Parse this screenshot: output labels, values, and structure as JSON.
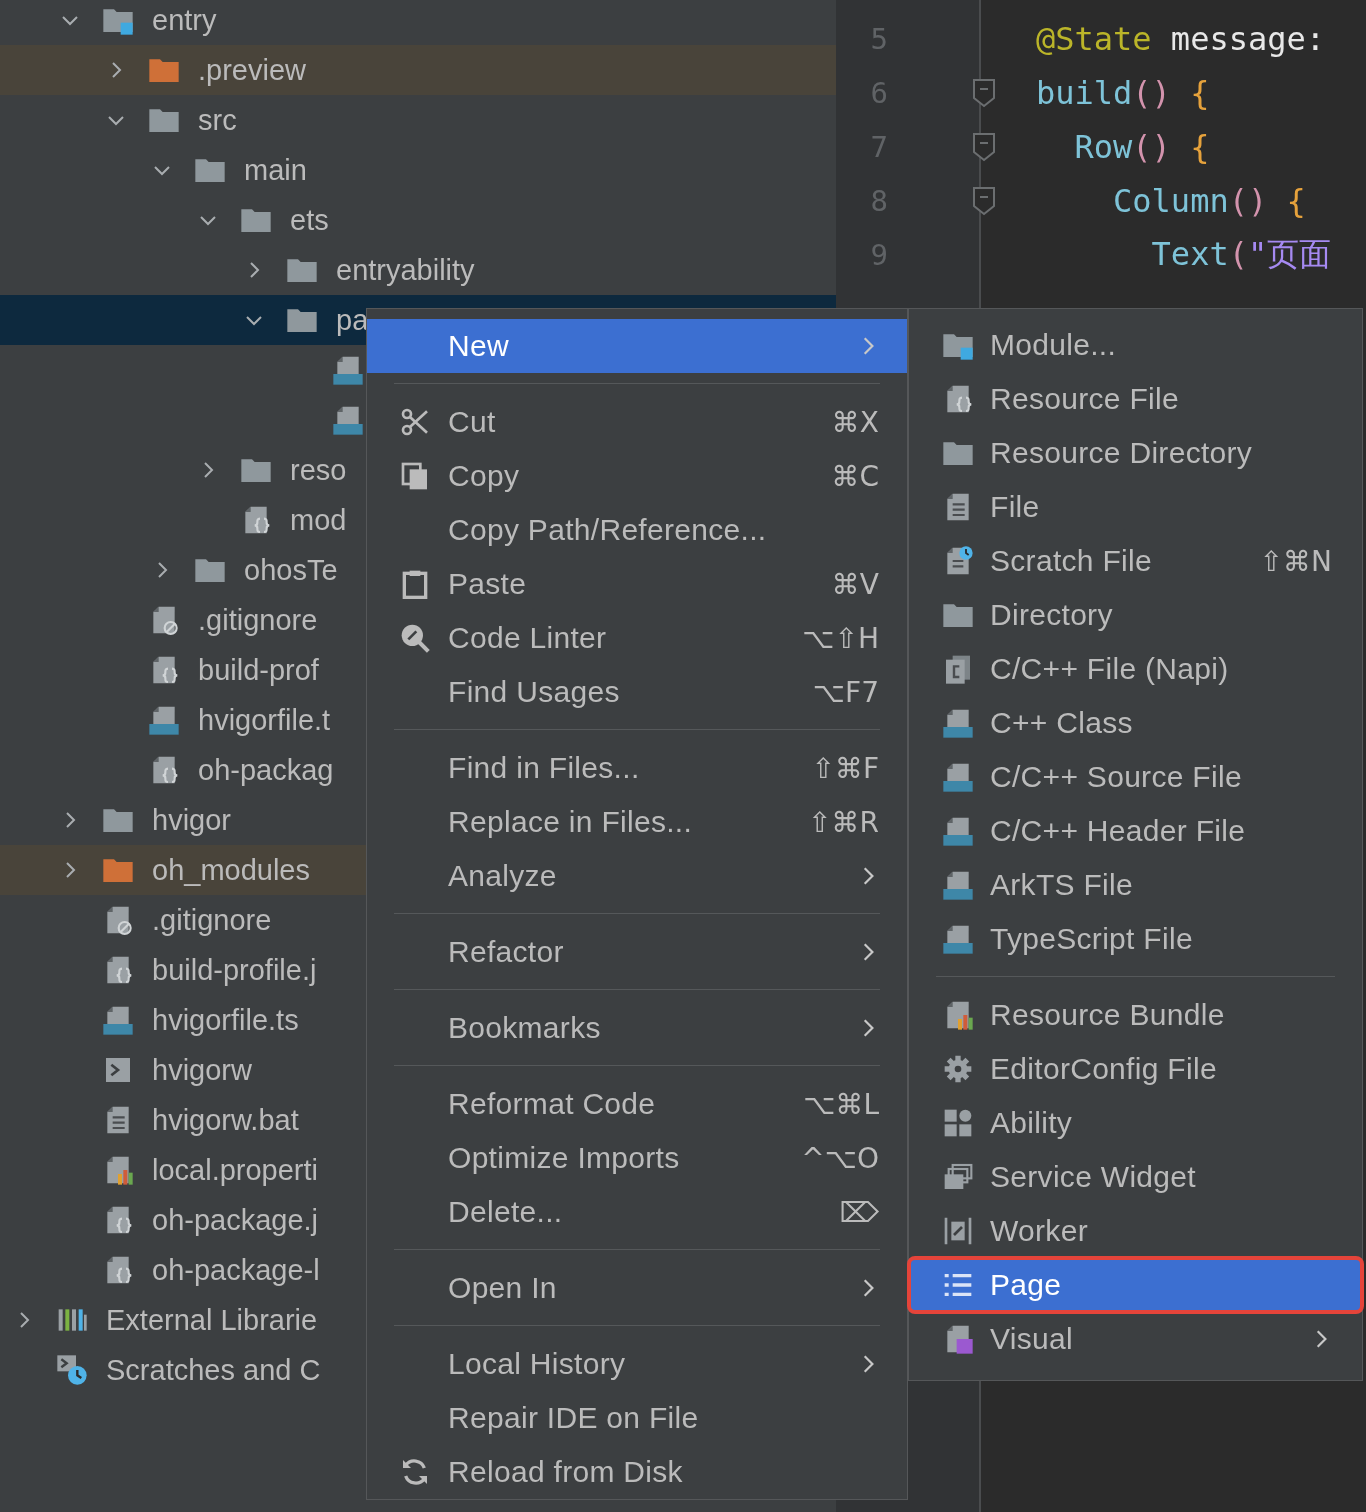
{
  "project_tree": {
    "items": [
      {
        "label": "entry",
        "kind": "module",
        "expanded": true,
        "selected": false,
        "children": [
          {
            "label": ".preview",
            "kind": "excluded-folder",
            "expanded": false,
            "selected": false
          },
          {
            "label": "src",
            "kind": "folder",
            "expanded": true,
            "selected": false,
            "children": [
              {
                "label": "main",
                "kind": "folder",
                "expanded": true,
                "selected": false,
                "children": [
                  {
                    "label": "ets",
                    "kind": "folder",
                    "expanded": true,
                    "selected": false,
                    "children": [
                      {
                        "label": "entryability",
                        "kind": "folder",
                        "expanded": false,
                        "selected": false
                      },
                      {
                        "label": "pa",
                        "kind": "folder",
                        "expanded": true,
                        "selected": true,
                        "children": [
                          {
                            "kind": "ets-file",
                            "selected": false
                          },
                          {
                            "kind": "ets-file",
                            "selected": false
                          }
                        ]
                      }
                    ]
                  },
                  {
                    "label": "reso",
                    "kind": "folder",
                    "expanded": false,
                    "selected": false
                  },
                  {
                    "label": "mod",
                    "kind": "json-file",
                    "selected": false
                  }
                ]
              },
              {
                "label": "ohosTe",
                "kind": "folder",
                "expanded": false,
                "selected": false
              }
            ]
          },
          {
            "label": ".gitignore",
            "kind": "ignore-file",
            "selected": false
          },
          {
            "label": "build-prof",
            "kind": "json-file",
            "selected": false
          },
          {
            "label": "hvigorfile.t",
            "kind": "ts-file",
            "selected": false
          },
          {
            "label": "oh-packag",
            "kind": "json-file",
            "selected": false
          }
        ]
      },
      {
        "label": "hvigor",
        "kind": "folder",
        "expanded": false,
        "selected": false
      },
      {
        "label": "oh_modules",
        "kind": "excluded-folder",
        "expanded": false,
        "selected": false
      },
      {
        "label": ".gitignore",
        "kind": "ignore-file",
        "selected": false
      },
      {
        "label": "build-profile.j",
        "kind": "json-file",
        "selected": false
      },
      {
        "label": "hvigorfile.ts",
        "kind": "ts-file",
        "selected": false
      },
      {
        "label": "hvigorw",
        "kind": "terminal-file",
        "selected": false
      },
      {
        "label": "hvigorw.bat",
        "kind": "text-file",
        "selected": false
      },
      {
        "label": "local.properti",
        "kind": "properties-file",
        "selected": false
      },
      {
        "label": "oh-package.j",
        "kind": "json-file",
        "selected": false
      },
      {
        "label": "oh-package-l",
        "kind": "json-file",
        "selected": false
      }
    ],
    "root_items": [
      {
        "label": "External Librarie",
        "kind": "libraries",
        "expanded": false,
        "selected": false
      },
      {
        "label": "Scratches and C",
        "kind": "scratches",
        "selected": false
      }
    ]
  },
  "editor": {
    "lines": [
      {
        "number": "5",
        "foldable": false,
        "tokens": [
          {
            "text": "@State",
            "kind": "decorator"
          },
          {
            "text": " message:",
            "kind": "plain"
          }
        ]
      },
      {
        "number": "6",
        "foldable": true,
        "tokens": [
          {
            "text": "build",
            "kind": "call"
          },
          {
            "text": "()",
            "kind": "paren"
          },
          {
            "text": " {",
            "kind": "brace"
          }
        ]
      },
      {
        "number": "7",
        "foldable": true,
        "tokens": [
          {
            "text": "  Row",
            "kind": "call"
          },
          {
            "text": "()",
            "kind": "paren"
          },
          {
            "text": " {",
            "kind": "brace"
          }
        ]
      },
      {
        "number": "8",
        "foldable": true,
        "tokens": [
          {
            "text": "    Column",
            "kind": "call"
          },
          {
            "text": "()",
            "kind": "paren"
          },
          {
            "text": " {",
            "kind": "brace"
          }
        ]
      },
      {
        "number": "9",
        "foldable": false,
        "tokens": [
          {
            "text": "      Text",
            "kind": "call"
          },
          {
            "text": "(",
            "kind": "paren"
          },
          {
            "text": "\"页面",
            "kind": "string"
          }
        ]
      }
    ]
  },
  "context_menu": {
    "groups": [
      [
        {
          "label": "New",
          "kind": "plain",
          "submenu": true,
          "selected": true
        }
      ],
      [
        {
          "label": "Cut",
          "kind": "cut",
          "shortcut": "⌘X",
          "submenu": false,
          "selected": false
        },
        {
          "label": "Copy",
          "kind": "copy",
          "shortcut": "⌘C",
          "submenu": false,
          "selected": false
        },
        {
          "label": "Copy Path/Reference...",
          "kind": "plain",
          "submenu": false,
          "selected": false
        },
        {
          "label": "Paste",
          "kind": "paste",
          "shortcut": "⌘V",
          "submenu": false,
          "selected": false
        },
        {
          "label": "Code Linter",
          "kind": "linter",
          "shortcut": "⌥⇧H",
          "submenu": false,
          "selected": false
        },
        {
          "label": "Find Usages",
          "kind": "plain",
          "shortcut": "⌥F7",
          "submenu": false,
          "selected": false
        }
      ],
      [
        {
          "label": "Find in Files...",
          "kind": "plain",
          "shortcut": "⇧⌘F",
          "submenu": false,
          "selected": false
        },
        {
          "label": "Replace in Files...",
          "kind": "plain",
          "shortcut": "⇧⌘R",
          "submenu": false,
          "selected": false
        },
        {
          "label": "Analyze",
          "kind": "plain",
          "submenu": true,
          "selected": false
        }
      ],
      [
        {
          "label": "Refactor",
          "kind": "plain",
          "submenu": true,
          "selected": false
        }
      ],
      [
        {
          "label": "Bookmarks",
          "kind": "plain",
          "submenu": true,
          "selected": false
        }
      ],
      [
        {
          "label": "Reformat Code",
          "kind": "plain",
          "shortcut": "⌥⌘L",
          "submenu": false,
          "selected": false
        },
        {
          "label": "Optimize Imports",
          "kind": "plain",
          "shortcut": "^⌥O",
          "submenu": false,
          "selected": false
        },
        {
          "label": "Delete...",
          "kind": "plain",
          "shortcut": "⌦",
          "submenu": false,
          "selected": false
        }
      ],
      [
        {
          "label": "Open In",
          "kind": "plain",
          "submenu": true,
          "selected": false
        }
      ],
      [
        {
          "label": "Local History",
          "kind": "plain",
          "submenu": true,
          "selected": false
        },
        {
          "label": "Repair IDE on File",
          "kind": "plain",
          "submenu": false,
          "selected": false
        },
        {
          "label": "Reload from Disk",
          "kind": "reload",
          "submenu": false,
          "selected": false
        }
      ]
    ]
  },
  "new_submenu": {
    "groups": [
      [
        {
          "label": "Module...",
          "kind": "module",
          "submenu": false,
          "selected": false,
          "outlined": false
        },
        {
          "label": "Resource File",
          "kind": "json-file",
          "submenu": false,
          "selected": false,
          "outlined": false
        },
        {
          "label": "Resource Directory",
          "kind": "folder",
          "submenu": false,
          "selected": false,
          "outlined": false
        },
        {
          "label": "File",
          "kind": "text-file",
          "submenu": false,
          "selected": false,
          "outlined": false
        },
        {
          "label": "Scratch File",
          "kind": "scratch-file",
          "shortcut": "⇧⌘N",
          "submenu": false,
          "selected": false,
          "outlined": false
        },
        {
          "label": "Directory",
          "kind": "folder",
          "submenu": false,
          "selected": false,
          "outlined": false
        },
        {
          "label": "C/C++ File (Napi)",
          "kind": "napi-file",
          "submenu": false,
          "selected": false,
          "outlined": false
        },
        {
          "label": "C++ Class",
          "kind": "cpp-file",
          "submenu": false,
          "selected": false,
          "outlined": false
        },
        {
          "label": "C/C++ Source File",
          "kind": "c-file",
          "submenu": false,
          "selected": false,
          "outlined": false
        },
        {
          "label": "C/C++ Header File",
          "kind": "h-file",
          "submenu": false,
          "selected": false,
          "outlined": false
        },
        {
          "label": "ArkTS File",
          "kind": "ets-file",
          "submenu": false,
          "selected": false,
          "outlined": false
        },
        {
          "label": "TypeScript File",
          "kind": "ts-file",
          "submenu": false,
          "selected": false,
          "outlined": false
        }
      ],
      [
        {
          "label": "Resource Bundle",
          "kind": "properties-file",
          "submenu": false,
          "selected": false,
          "outlined": false
        },
        {
          "label": "EditorConfig File",
          "kind": "gear",
          "submenu": false,
          "selected": false,
          "outlined": false
        },
        {
          "label": "Ability",
          "kind": "ability",
          "submenu": false,
          "selected": false,
          "outlined": false
        },
        {
          "label": "Service Widget",
          "kind": "widget",
          "submenu": false,
          "selected": false,
          "outlined": false
        },
        {
          "label": "Worker",
          "kind": "worker",
          "submenu": false,
          "selected": false,
          "outlined": false
        },
        {
          "label": "Page",
          "kind": "page",
          "submenu": false,
          "selected": true,
          "outlined": true
        },
        {
          "label": "Visual",
          "kind": "visual",
          "submenu": true,
          "selected": false,
          "outlined": false
        }
      ]
    ]
  }
}
